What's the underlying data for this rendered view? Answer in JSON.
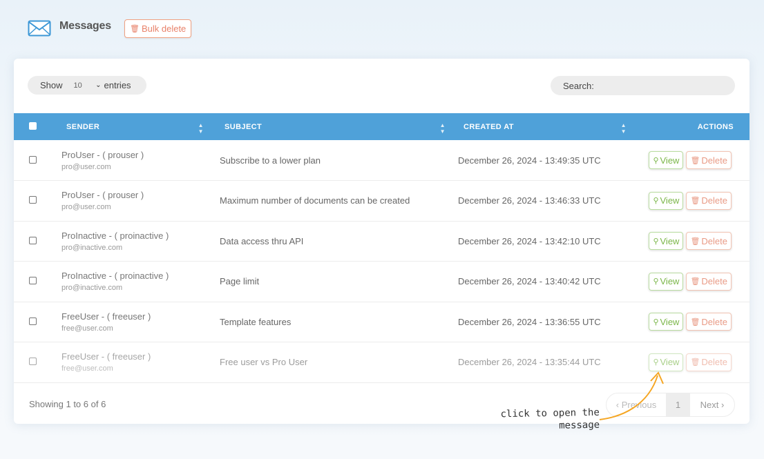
{
  "header": {
    "title": "Messages",
    "bulk_delete_label": "Bulk delete"
  },
  "controls": {
    "show_label": "Show",
    "entries_value": "10",
    "entries_label": "entries",
    "search_label": "Search:",
    "search_value": ""
  },
  "table": {
    "columns": [
      "SENDER",
      "SUBJECT",
      "CREATED AT",
      "ACTIONS"
    ],
    "view_label": "View",
    "delete_label": "Delete",
    "rows": [
      {
        "sender": "ProUser - ( prouser )",
        "email": "pro@user.com",
        "subject": "Subscribe to a lower plan",
        "created_at": "December 26, 2024 - 13:49:35 UTC"
      },
      {
        "sender": "ProUser - ( prouser )",
        "email": "pro@user.com",
        "subject": "Maximum number of documents can be created",
        "created_at": "December 26, 2024 - 13:46:33 UTC"
      },
      {
        "sender": "ProInactive - ( proinactive )",
        "email": "pro@inactive.com",
        "subject": "Data access thru API",
        "created_at": "December 26, 2024 - 13:42:10 UTC"
      },
      {
        "sender": "ProInactive - ( proinactive )",
        "email": "pro@inactive.com",
        "subject": "Page limit",
        "created_at": "December 26, 2024 - 13:40:42 UTC"
      },
      {
        "sender": "FreeUser - ( freeuser )",
        "email": "free@user.com",
        "subject": "Template features",
        "created_at": "December 26, 2024 - 13:36:55 UTC"
      },
      {
        "sender": "FreeUser - ( freeuser )",
        "email": "free@user.com",
        "subject": "Free user vs Pro User",
        "created_at": "December 26, 2024 - 13:35:44 UTC"
      }
    ]
  },
  "footer": {
    "info": "Showing 1 to 6 of 6",
    "prev_label": "Previous",
    "current_page": "1",
    "next_label": "Next"
  },
  "annotation": {
    "line1": "click to open the",
    "line2": "message"
  },
  "colors": {
    "header_blue": "#4fa1d9",
    "view_green": "#7ab648",
    "delete_salmon": "#e99a85",
    "arrow_orange": "#f5a623"
  }
}
